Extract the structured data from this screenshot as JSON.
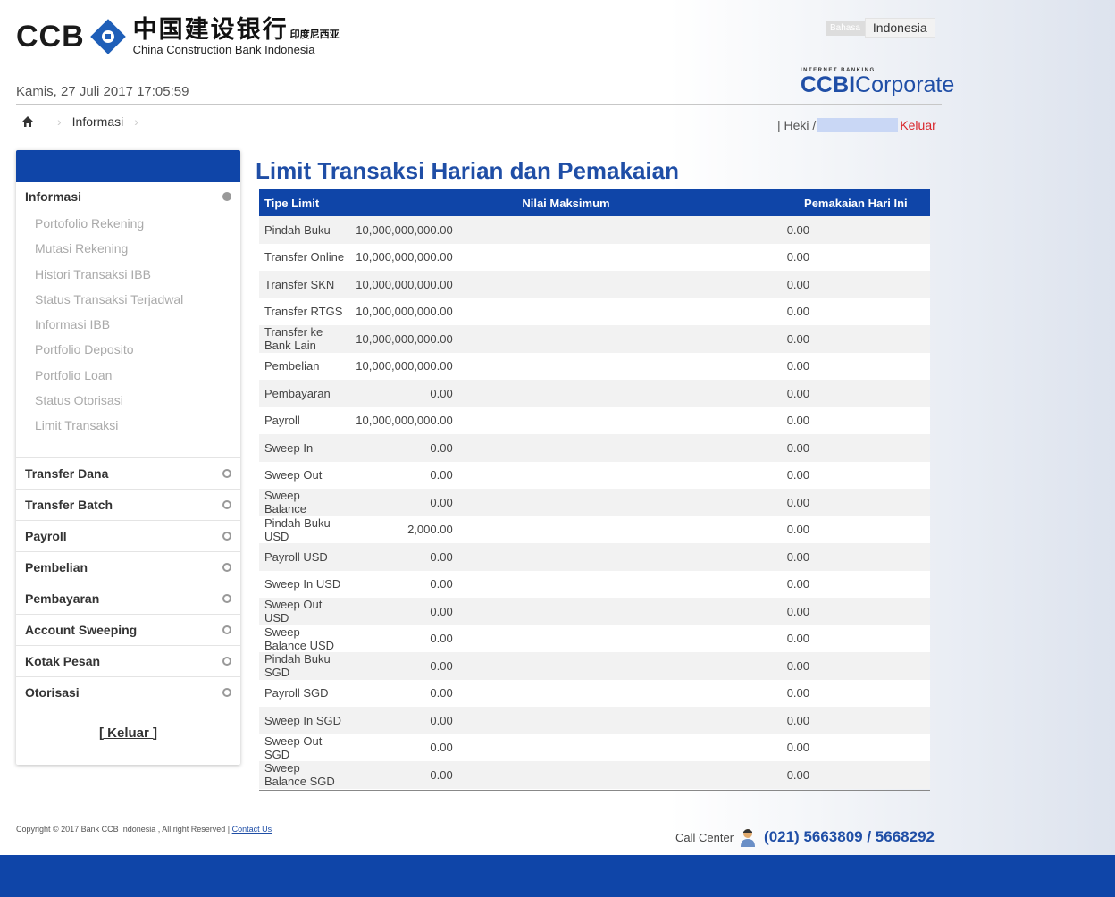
{
  "header": {
    "logo_ccb": "CCB",
    "logo_cn": "中国建设银行",
    "logo_cn_small": "印度尼西亚",
    "logo_en": "China Construction Bank Indonesia",
    "lang_label": "Bahasa",
    "lang_value": "Indonesia",
    "ib_small": "INTERNET BANKING",
    "ib_brand_bold": "CCBI",
    "ib_brand_rest": "Corporate",
    "date": "Kamis, 27 Juli 2017 17:05:59",
    "breadcrumb": "Informasi",
    "user_prefix": "| Heki /",
    "logout": "Keluar"
  },
  "sidebar": {
    "section_title": "Informasi",
    "sub_items": [
      "Portofolio Rekening",
      "Mutasi Rekening",
      "Histori Transaksi IBB",
      "Status Transaksi Terjadwal",
      "Informasi IBB",
      "Portfolio Deposito",
      "Portfolio Loan",
      "Status Otorisasi",
      "Limit Transaksi"
    ],
    "menu_items": [
      "Transfer Dana",
      "Transfer Batch",
      "Payroll",
      "Pembelian",
      "Pembayaran",
      "Account Sweeping",
      "Kotak Pesan",
      "Otorisasi"
    ],
    "logout": "[ Keluar ]"
  },
  "main": {
    "title": "Limit Transaksi Harian dan Pemakaian",
    "columns": [
      "Tipe Limit",
      "Nilai Maksimum",
      "Pemakaian Hari Ini"
    ],
    "rows": [
      [
        "Pindah Buku",
        "10,000,000,000.00",
        "0.00"
      ],
      [
        "Transfer Online",
        "10,000,000,000.00",
        "0.00"
      ],
      [
        "Transfer SKN",
        "10,000,000,000.00",
        "0.00"
      ],
      [
        "Transfer RTGS",
        "10,000,000,000.00",
        "0.00"
      ],
      [
        "Transfer ke Bank Lain",
        "10,000,000,000.00",
        "0.00"
      ],
      [
        "Pembelian",
        "10,000,000,000.00",
        "0.00"
      ],
      [
        "Pembayaran",
        "0.00",
        "0.00"
      ],
      [
        "Payroll",
        "10,000,000,000.00",
        "0.00"
      ],
      [
        "Sweep In",
        "0.00",
        "0.00"
      ],
      [
        "Sweep Out",
        "0.00",
        "0.00"
      ],
      [
        "Sweep Balance",
        "0.00",
        "0.00"
      ],
      [
        "Pindah Buku USD",
        "2,000.00",
        "0.00"
      ],
      [
        "Payroll USD",
        "0.00",
        "0.00"
      ],
      [
        "Sweep In USD",
        "0.00",
        "0.00"
      ],
      [
        "Sweep Out USD",
        "0.00",
        "0.00"
      ],
      [
        "Sweep Balance USD",
        "0.00",
        "0.00"
      ],
      [
        "Pindah Buku SGD",
        "0.00",
        "0.00"
      ],
      [
        "Payroll SGD",
        "0.00",
        "0.00"
      ],
      [
        "Sweep In SGD",
        "0.00",
        "0.00"
      ],
      [
        "Sweep Out SGD",
        "0.00",
        "0.00"
      ],
      [
        "Sweep Balance SGD",
        "0.00",
        "0.00"
      ]
    ]
  },
  "footer": {
    "copyright": "Copyright © 2017 Bank CCB Indonesia , All right Reserved |",
    "contact": "Contact Us",
    "call_label": "Call Center",
    "call_number": "(021) 5663809 / 5668292"
  },
  "colors": {
    "primary_blue": "#0f45a8",
    "title_blue": "#1f4ea6",
    "logout_red": "#d9262b"
  }
}
